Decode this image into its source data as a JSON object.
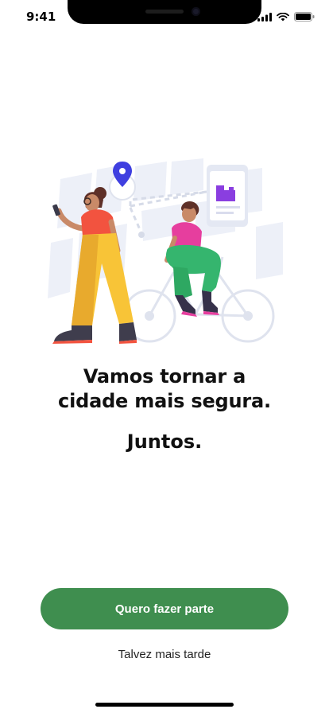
{
  "status_bar": {
    "time": "9:41",
    "icons": [
      "cellular-signal-icon",
      "wifi-icon",
      "battery-icon"
    ]
  },
  "illustration": {
    "name": "city-people-illustration",
    "sign_icon": "building-icon",
    "pin_icon": "location-pin-icon"
  },
  "onboarding": {
    "headline_line1": "Vamos tornar a",
    "headline_line2": "cidade mais segura.",
    "subline": "Juntos."
  },
  "actions": {
    "primary_label": "Quero fazer parte",
    "secondary_label": "Talvez mais tarde"
  },
  "colors": {
    "primary": "#3f8e4f",
    "pin": "#3f3fe0",
    "accent_purple": "#8a3ee0"
  }
}
